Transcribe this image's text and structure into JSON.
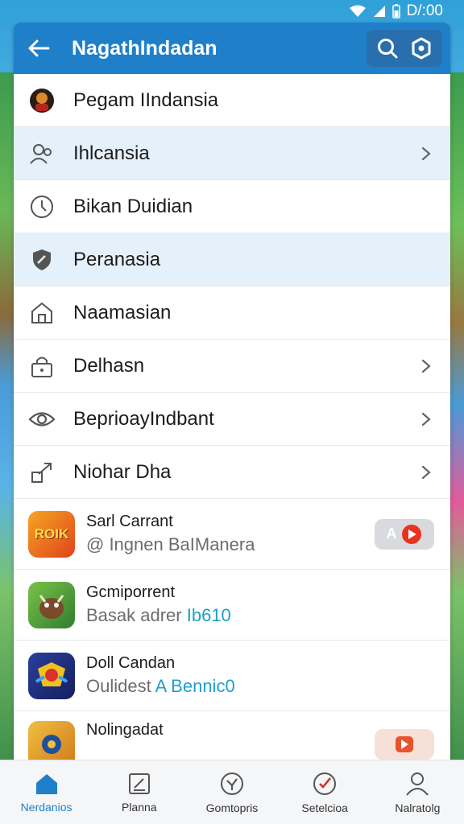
{
  "status_bar": {
    "time": "D/:00",
    "icons": [
      "wifi-icon",
      "signal-icon",
      "battery-icon"
    ]
  },
  "app_bar": {
    "title": "NagathIndadan",
    "back_icon": "arrow-left-icon",
    "actions": [
      "search-icon",
      "settings-icon"
    ],
    "color": "#1f7fc8"
  },
  "menu": [
    {
      "label": "Pegam IIndansia",
      "icon": "avatar-icon",
      "chevron": false,
      "highlight": false
    },
    {
      "label": "Ihlcansia",
      "icon": "user-group-icon",
      "chevron": true,
      "highlight": true
    },
    {
      "label": "Bikan Duidian",
      "icon": "clock-icon",
      "chevron": false,
      "highlight": false
    },
    {
      "label": "Peranasia",
      "icon": "shield-icon",
      "chevron": false,
      "highlight": true
    },
    {
      "label": "Naamasian",
      "icon": "home-icon",
      "chevron": false,
      "highlight": false
    },
    {
      "label": "Delhasn",
      "icon": "lock-icon",
      "chevron": true,
      "highlight": false
    },
    {
      "label": "BeprioayIndbant",
      "icon": "eye-icon",
      "chevron": true,
      "highlight": false
    },
    {
      "label": "Niohar Dha",
      "icon": "share-icon",
      "chevron": true,
      "highlight": false
    }
  ],
  "apps": [
    {
      "name": "Sarl Carrant",
      "sub_prefix": "@ Ingnen BaIManera",
      "sub_accent": "",
      "icon_text": "ROIK",
      "badge": "A"
    },
    {
      "name": "Gcmiporrent",
      "sub_prefix": "Basak adrer ",
      "sub_accent": "Ib610",
      "icon_text": "",
      "badge": ""
    },
    {
      "name": "Doll Candan",
      "sub_prefix": "Oulidest ",
      "sub_accent": "A Bennic0",
      "icon_text": "",
      "badge": ""
    },
    {
      "name": "Nolingadat",
      "sub_prefix": "",
      "sub_accent": "",
      "icon_text": "",
      "badge": ""
    }
  ],
  "bottom_nav": [
    {
      "label": "Nerdanios",
      "icon": "home-icon",
      "active": true
    },
    {
      "label": "Planna",
      "icon": "edit-icon",
      "active": false
    },
    {
      "label": "Gomtopris",
      "icon": "compass-icon",
      "active": false
    },
    {
      "label": "Setelcioa",
      "icon": "check-circle-icon",
      "active": false
    },
    {
      "label": "Nalratolg",
      "icon": "profile-icon",
      "active": false
    }
  ]
}
